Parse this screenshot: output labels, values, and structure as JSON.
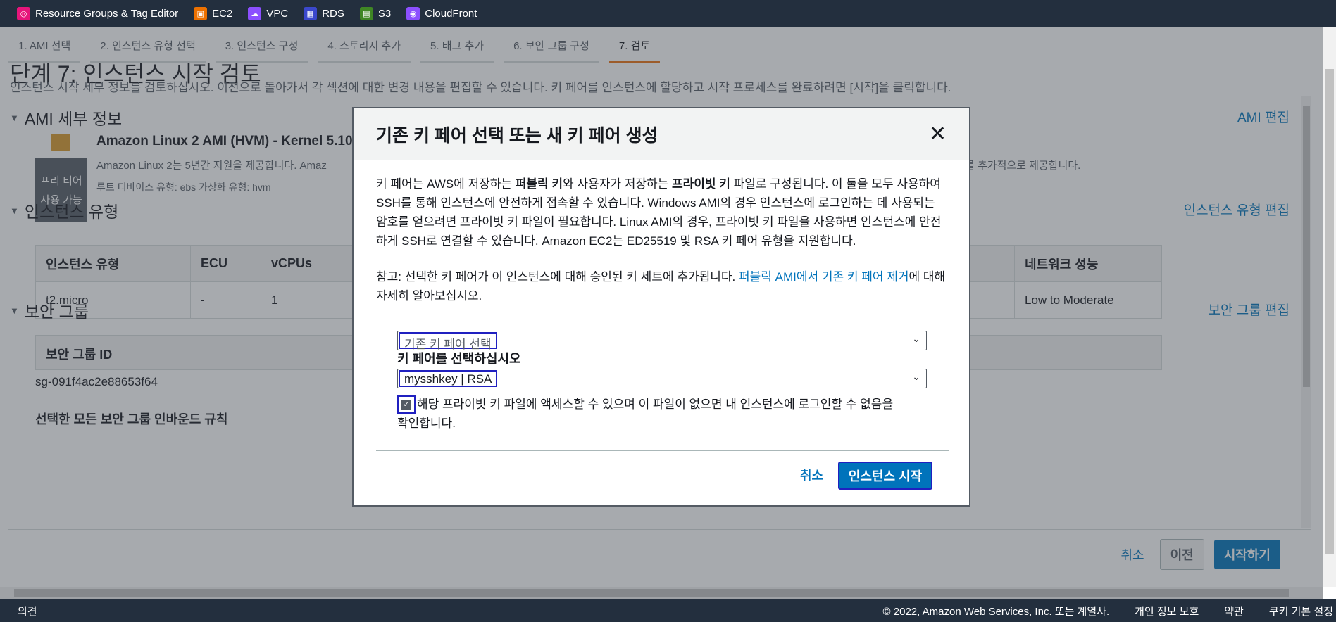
{
  "favorites": [
    {
      "label": "Resource Groups & Tag Editor",
      "icon": "resource-groups-icon",
      "color": "#e7157b",
      "glyph": "◎"
    },
    {
      "label": "EC2",
      "icon": "ec2-icon",
      "color": "#ed7100",
      "glyph": "▣"
    },
    {
      "label": "VPC",
      "icon": "vpc-icon",
      "color": "#8c4fff",
      "glyph": "☁"
    },
    {
      "label": "RDS",
      "icon": "rds-icon",
      "color": "#3b48cc",
      "glyph": "▦"
    },
    {
      "label": "S3",
      "icon": "s3-icon",
      "color": "#3f8624",
      "glyph": "▤"
    },
    {
      "label": "CloudFront",
      "icon": "cloudfront-icon",
      "color": "#8c4fff",
      "glyph": "◉"
    }
  ],
  "steps": [
    "1. AMI 선택",
    "2. 인스턴스 유형 선택",
    "3. 인스턴스 구성",
    "4. 스토리지 추가",
    "5. 태그 추가",
    "6. 보안 그룹 구성",
    "7. 검토"
  ],
  "page": {
    "title": "단계 7: 인스턴스 시작 검토",
    "description": "인스턴스 시작 세부 정보를 검토하십시오. 이전으로 돌아가서 각 섹션에 대한 변경 내용을 편집할 수 있습니다. 키 페어를 인스턴스에 할당하고 시작 프로세스를 완료하려면 [시작]을 클릭합니다."
  },
  "ami": {
    "heading": "AMI 세부 정보",
    "edit": "AMI 편집",
    "name": "Amazon Linux 2 AMI (HVM) - Kernel 5.10,",
    "desc": "Amazon Linux 2는 5년간 지원을 제공합니다. Amaz",
    "desc_tail": "를 추가적으로 제공합니다.",
    "free_tier_1": "프리 티어",
    "free_tier_2": "사용 가능",
    "meta": "루트 디바이스 유형: ebs     가상화 유형: hvm"
  },
  "instance_type": {
    "heading": "인스턴스 유형",
    "edit": "인스턴스 유형 편집",
    "columns": [
      "인스턴스 유형",
      "ECU",
      "vCPUs",
      "네트워크 성능"
    ],
    "row": [
      "t2.micro",
      "-",
      "1",
      "Low to Moderate"
    ]
  },
  "security_group": {
    "heading": "보안 그룹",
    "edit": "보안 그룹 편집",
    "col": "보안 그룹 ID",
    "id": "sg-091f4ac2e88653f64",
    "rules": "선택한 모든 보안 그룹 인바운드 규칙"
  },
  "bottom": {
    "cancel": "취소",
    "prev": "이전",
    "launch": "시작하기"
  },
  "footer": {
    "feedback": "의견",
    "copyright": "© 2022, Amazon Web Services, Inc. 또는 계열사.",
    "privacy": "개인 정보 보호",
    "terms": "약관",
    "cookies": "쿠키 기본 설정"
  },
  "modal": {
    "title": "기존 키 페어 선택 또는 새 키 페어 생성",
    "intro_1": "키 페어는 AWS에 저장하는 ",
    "intro_b1": "퍼블릭 키",
    "intro_2": "와 사용자가 저장하는 ",
    "intro_b2": "프라이빗 키",
    "intro_3": " 파일로 구성됩니다. 이 둘을 모두 사용하여 SSH를 통해 인스턴스에 안전하게 접속할 수 있습니다. Windows AMI의 경우 인스턴스에 로그인하는 데 사용되는 암호를 얻으려면 프라이빗 키 파일이 필요합니다. Linux AMI의 경우, 프라이빗 키 파일을 사용하면 인스턴스에 안전하게 SSH로 연결할 수 있습니다. Amazon EC2는 ED25519 및 RSA 키 페어 유형을 지원합니다.",
    "note_1": "참고: 선택한 키 페어가 이 인스턴스에 대해 승인된 키 세트에 추가됩니다. ",
    "note_link": "퍼블릭 AMI에서 기존 키 페어 제거",
    "note_2": "에 대해 자세히 알아보십시오.",
    "keypair_mode": "기존 키 페어 선택",
    "keypair_label": "키 페어를 선택하십시오",
    "keypair_value": "mysshkey | RSA",
    "ack": "해당 프라이빗 키 파일에 액세스할 수 있으며 이 파일이 없으면 내 인스턴스에 로그인할 수 없음을 확인합니다.",
    "ack_checked": true,
    "cancel": "취소",
    "launch": "인스턴스 시작"
  }
}
